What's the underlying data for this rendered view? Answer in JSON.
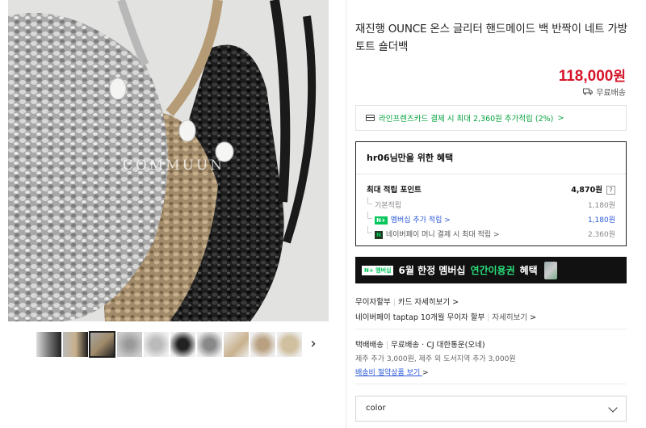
{
  "product": {
    "title": "재진행 OUNCE 온스 글리터 핸드메이드 백 반짝이 네트 가방 토트 숄더백",
    "price_number": "118,000",
    "price_unit": "원",
    "shipping": "무료배송",
    "image_watermark": "COMMUUN"
  },
  "card_banner": {
    "text": "라인프렌즈카드 결제 시 최대 2,360원 추가적립 (2%)",
    "chevron": ">"
  },
  "benefits": {
    "title": "hr06님만을 위한 혜택",
    "max_points_label": "최대 적립 포인트",
    "max_points_value": "4,870원",
    "help": "?",
    "rows": [
      {
        "label": "기본적립",
        "value": "1,180원"
      },
      {
        "badge": "N+",
        "label": "멤버십 추가 적립 >",
        "value": "1,180원"
      },
      {
        "badge": "N",
        "label": "네이버페이 머니 결제 시 최대 적립 >",
        "value": "2,360원"
      }
    ]
  },
  "promo": {
    "badge": "N+ 멤버십",
    "text_before": "6월 한정 멤버십",
    "text_highlight": "연간이용권",
    "text_after": "혜택"
  },
  "payment": {
    "installment": "무이자할부",
    "card_details": "카드 자세히보기",
    "card_details_chevron": ">",
    "naverpay_text": "네이버페이 taptap 10개월 무이자 할부",
    "details": "자세히보기",
    "details_chevron": ">"
  },
  "delivery": {
    "type": "택배배송",
    "fee": "무료배송",
    "carrier": "· CJ 대한통운(오네)",
    "extra": "제주 추가 3,000원, 제주 외 도서지역 추가 3,000원",
    "policy_link": "배송비 절약상품 보기",
    "policy_chevron": ">"
  },
  "option_select": {
    "placeholder": "color"
  },
  "colors": {
    "price_red": "#d6172b",
    "naver_green": "#03c75a",
    "link_blue": "#2d5ad9"
  }
}
